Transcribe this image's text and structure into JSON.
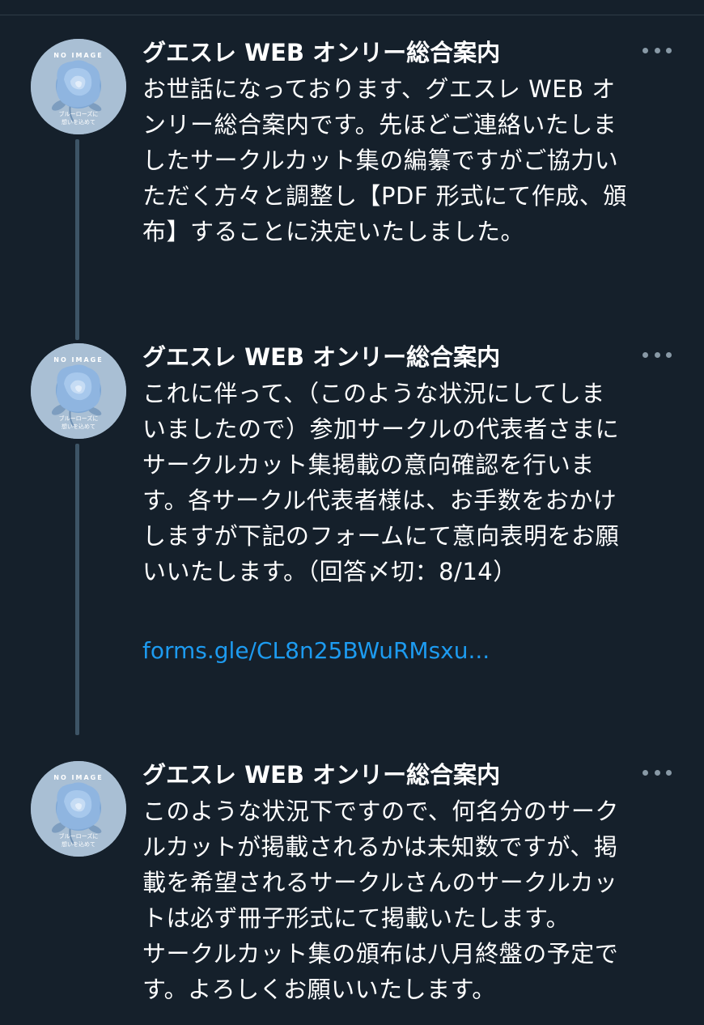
{
  "avatar": {
    "top_text": "NO IMAGE",
    "bottom_text_1": "ブルーローズに",
    "bottom_text_2": "想いを込めて"
  },
  "tweets": [
    {
      "author": "グエスレ WEB オンリー総合案内",
      "body": "お世話になっております、グエスレ WEB オ\nンリー総合案内です。先ほどご連絡いたしま\nしたサークルカット集の編纂ですがご協力い\nただく方々と調整し【PDF 形式にて作成、頒\n布】することに決定いたしました。"
    },
    {
      "author": "グエスレ WEB オンリー総合案内",
      "body": "これに伴って、（このような状況にしてしま\nいましたので）参加サークルの代表者さまに\nサークルカット集掲載の意向確認を行いま\nす。各サークル代表者様は、お手数をおかけ\nしますが下記のフォームにて意向表明をお願\nいいたします。（回答〆切：8/14）",
      "link": "forms.gle/CL8n25BWuRMsxu..."
    },
    {
      "author": "グエスレ WEB オンリー総合案内",
      "body": "このような状況下ですので、何名分のサーク\nルカットが掲載されるかは未知数ですが、掲\n載を希望されるサークルさんのサークルカッ\nトは必ず冊子形式にて掲載いたします。\nサークルカット集の頒布は八月終盤の予定で\nす。よろしくお願いいたします。"
    }
  ],
  "icons": {
    "more": "more-horizontal-icon",
    "avatar": "blue-rose-avatar"
  },
  "colors": {
    "background": "#15202b",
    "text": "#ffffff",
    "link": "#1d9bf0",
    "thread_line": "#3d5466",
    "muted": "#8899a6"
  }
}
